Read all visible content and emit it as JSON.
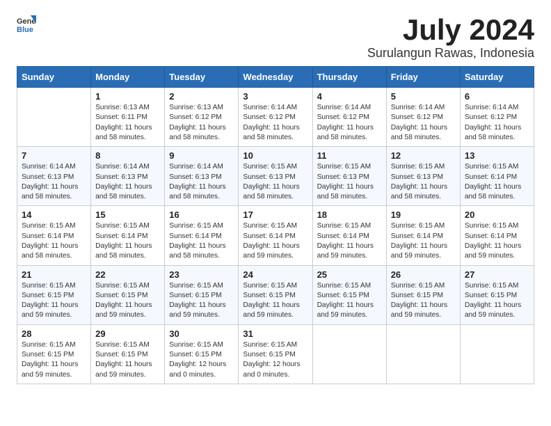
{
  "logo": {
    "general": "General",
    "blue": "Blue"
  },
  "title": {
    "month": "July 2024",
    "location": "Surulangun Rawas, Indonesia"
  },
  "weekdays": [
    "Sunday",
    "Monday",
    "Tuesday",
    "Wednesday",
    "Thursday",
    "Friday",
    "Saturday"
  ],
  "weeks": [
    [
      {
        "day": "",
        "content": ""
      },
      {
        "day": "1",
        "content": "Sunrise: 6:13 AM\nSunset: 6:11 PM\nDaylight: 11 hours\nand 58 minutes."
      },
      {
        "day": "2",
        "content": "Sunrise: 6:13 AM\nSunset: 6:12 PM\nDaylight: 11 hours\nand 58 minutes."
      },
      {
        "day": "3",
        "content": "Sunrise: 6:14 AM\nSunset: 6:12 PM\nDaylight: 11 hours\nand 58 minutes."
      },
      {
        "day": "4",
        "content": "Sunrise: 6:14 AM\nSunset: 6:12 PM\nDaylight: 11 hours\nand 58 minutes."
      },
      {
        "day": "5",
        "content": "Sunrise: 6:14 AM\nSunset: 6:12 PM\nDaylight: 11 hours\nand 58 minutes."
      },
      {
        "day": "6",
        "content": "Sunrise: 6:14 AM\nSunset: 6:12 PM\nDaylight: 11 hours\nand 58 minutes."
      }
    ],
    [
      {
        "day": "7",
        "content": "Sunrise: 6:14 AM\nSunset: 6:13 PM\nDaylight: 11 hours\nand 58 minutes."
      },
      {
        "day": "8",
        "content": "Sunrise: 6:14 AM\nSunset: 6:13 PM\nDaylight: 11 hours\nand 58 minutes."
      },
      {
        "day": "9",
        "content": "Sunrise: 6:14 AM\nSunset: 6:13 PM\nDaylight: 11 hours\nand 58 minutes."
      },
      {
        "day": "10",
        "content": "Sunrise: 6:15 AM\nSunset: 6:13 PM\nDaylight: 11 hours\nand 58 minutes."
      },
      {
        "day": "11",
        "content": "Sunrise: 6:15 AM\nSunset: 6:13 PM\nDaylight: 11 hours\nand 58 minutes."
      },
      {
        "day": "12",
        "content": "Sunrise: 6:15 AM\nSunset: 6:13 PM\nDaylight: 11 hours\nand 58 minutes."
      },
      {
        "day": "13",
        "content": "Sunrise: 6:15 AM\nSunset: 6:14 PM\nDaylight: 11 hours\nand 58 minutes."
      }
    ],
    [
      {
        "day": "14",
        "content": "Sunrise: 6:15 AM\nSunset: 6:14 PM\nDaylight: 11 hours\nand 58 minutes."
      },
      {
        "day": "15",
        "content": "Sunrise: 6:15 AM\nSunset: 6:14 PM\nDaylight: 11 hours\nand 58 minutes."
      },
      {
        "day": "16",
        "content": "Sunrise: 6:15 AM\nSunset: 6:14 PM\nDaylight: 11 hours\nand 58 minutes."
      },
      {
        "day": "17",
        "content": "Sunrise: 6:15 AM\nSunset: 6:14 PM\nDaylight: 11 hours\nand 59 minutes."
      },
      {
        "day": "18",
        "content": "Sunrise: 6:15 AM\nSunset: 6:14 PM\nDaylight: 11 hours\nand 59 minutes."
      },
      {
        "day": "19",
        "content": "Sunrise: 6:15 AM\nSunset: 6:14 PM\nDaylight: 11 hours\nand 59 minutes."
      },
      {
        "day": "20",
        "content": "Sunrise: 6:15 AM\nSunset: 6:14 PM\nDaylight: 11 hours\nand 59 minutes."
      }
    ],
    [
      {
        "day": "21",
        "content": "Sunrise: 6:15 AM\nSunset: 6:15 PM\nDaylight: 11 hours\nand 59 minutes."
      },
      {
        "day": "22",
        "content": "Sunrise: 6:15 AM\nSunset: 6:15 PM\nDaylight: 11 hours\nand 59 minutes."
      },
      {
        "day": "23",
        "content": "Sunrise: 6:15 AM\nSunset: 6:15 PM\nDaylight: 11 hours\nand 59 minutes."
      },
      {
        "day": "24",
        "content": "Sunrise: 6:15 AM\nSunset: 6:15 PM\nDaylight: 11 hours\nand 59 minutes."
      },
      {
        "day": "25",
        "content": "Sunrise: 6:15 AM\nSunset: 6:15 PM\nDaylight: 11 hours\nand 59 minutes."
      },
      {
        "day": "26",
        "content": "Sunrise: 6:15 AM\nSunset: 6:15 PM\nDaylight: 11 hours\nand 59 minutes."
      },
      {
        "day": "27",
        "content": "Sunrise: 6:15 AM\nSunset: 6:15 PM\nDaylight: 11 hours\nand 59 minutes."
      }
    ],
    [
      {
        "day": "28",
        "content": "Sunrise: 6:15 AM\nSunset: 6:15 PM\nDaylight: 11 hours\nand 59 minutes."
      },
      {
        "day": "29",
        "content": "Sunrise: 6:15 AM\nSunset: 6:15 PM\nDaylight: 11 hours\nand 59 minutes."
      },
      {
        "day": "30",
        "content": "Sunrise: 6:15 AM\nSunset: 6:15 PM\nDaylight: 12 hours\nand 0 minutes."
      },
      {
        "day": "31",
        "content": "Sunrise: 6:15 AM\nSunset: 6:15 PM\nDaylight: 12 hours\nand 0 minutes."
      },
      {
        "day": "",
        "content": ""
      },
      {
        "day": "",
        "content": ""
      },
      {
        "day": "",
        "content": ""
      }
    ]
  ]
}
